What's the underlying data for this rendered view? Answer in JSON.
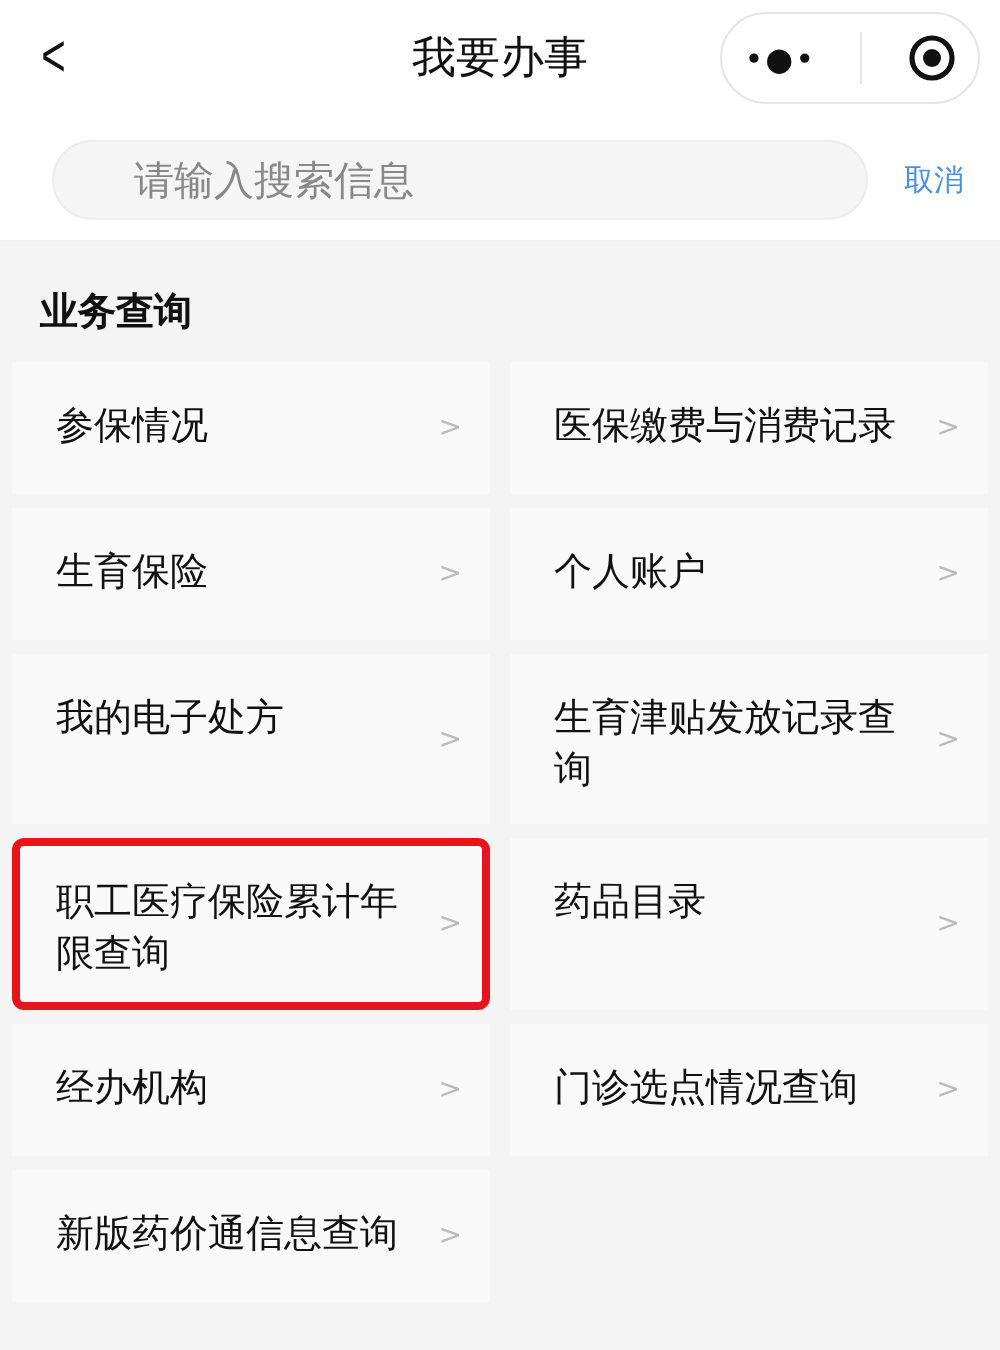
{
  "header": {
    "back": "<",
    "title": "我要办事",
    "more": "•●•"
  },
  "search": {
    "placeholder": "请输入搜索信息",
    "cancel": "取消"
  },
  "section": {
    "title": "业务查询"
  },
  "items": [
    {
      "label": "参保情况",
      "chevron": ">",
      "highlighted": false
    },
    {
      "label": "医保缴费与消费记录",
      "chevron": ">",
      "highlighted": false
    },
    {
      "label": "生育保险",
      "chevron": ">",
      "highlighted": false
    },
    {
      "label": "个人账户",
      "chevron": ">",
      "highlighted": false
    },
    {
      "label": "我的电子处方",
      "chevron": ">",
      "highlighted": false
    },
    {
      "label": "生育津贴发放记录查询",
      "chevron": ">",
      "highlighted": false
    },
    {
      "label": "职工医疗保险累计年限查询",
      "chevron": ">",
      "highlighted": true
    },
    {
      "label": "药品目录",
      "chevron": ">",
      "highlighted": false
    },
    {
      "label": "经办机构",
      "chevron": ">",
      "highlighted": false
    },
    {
      "label": "门诊选点情况查询",
      "chevron": ">",
      "highlighted": false
    },
    {
      "label": "新版药价通信息查询",
      "chevron": ">",
      "highlighted": false
    }
  ]
}
